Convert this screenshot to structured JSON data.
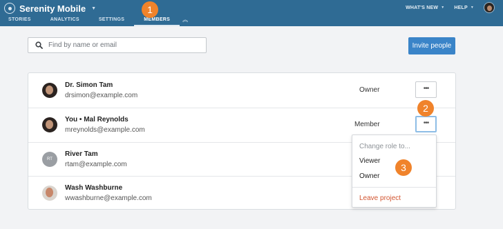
{
  "app": {
    "title": "Serenity Mobile"
  },
  "tabs": [
    {
      "label": "STORIES"
    },
    {
      "label": "ANALYTICS"
    },
    {
      "label": "SETTINGS"
    },
    {
      "label": "MEMBERS",
      "active": true
    }
  ],
  "nav": {
    "whats_new": "WHAT'S NEW",
    "help": "HELP"
  },
  "search": {
    "placeholder": "Find by name or email",
    "value": ""
  },
  "invite_button": "Invite people",
  "members": [
    {
      "name": "Dr. Simon Tam",
      "email": "drsimon@example.com",
      "role": "Owner",
      "avatar": "photo"
    },
    {
      "name": "You • Mal Reynolds",
      "email": "mreynolds@example.com",
      "role": "Member",
      "avatar": "photo"
    },
    {
      "name": "River Tam",
      "email": "rtam@example.com",
      "role": "",
      "avatar": "initials",
      "initials": "RT"
    },
    {
      "name": "Wash Washburne",
      "email": "wwashburne@example.com",
      "role": "",
      "avatar": "photo-light"
    }
  ],
  "more_button_label": "•••",
  "dropdown": {
    "header": "Change role to...",
    "options": [
      "Viewer",
      "Owner"
    ],
    "leave": "Leave project"
  },
  "markers": [
    "1",
    "2",
    "3"
  ],
  "colors": {
    "topbar": "#2f6b94",
    "accent": "#3a84c8",
    "marker": "#f0832b",
    "danger": "#d2542f"
  }
}
